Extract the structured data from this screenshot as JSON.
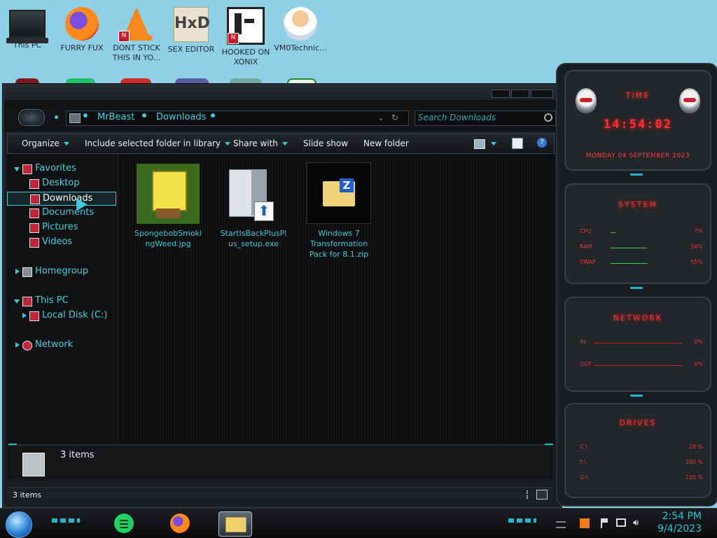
{
  "desktop": {
    "icons": [
      {
        "label": "This PC"
      },
      {
        "label": "FURRY FUX"
      },
      {
        "label": "DONT STICK THIS IN YO..."
      },
      {
        "label": "SEX EDITOR"
      },
      {
        "label": "HOOKED ON XONIX"
      },
      {
        "label": "VM0Technic..."
      }
    ]
  },
  "explorer": {
    "breadcrumb": [
      "MrBeast",
      "Downloads"
    ],
    "search_placeholder": "Search Downloads",
    "toolbar": {
      "organize": "Organize",
      "include": "Include selected folder in library",
      "share": "Share with",
      "slideshow": "Slide show",
      "new_folder": "New folder"
    },
    "nav": {
      "favorites": "Favorites",
      "desktop": "Desktop",
      "downloads": "Downloads",
      "documents": "Documents",
      "pictures": "Pictures",
      "videos": "Videos",
      "homegroup": "Homegroup",
      "this_pc": "This PC",
      "local_disk": "Local Disk (C:)",
      "network": "Network"
    },
    "files": [
      {
        "name": "SpongebobSmokingWeed.jpg"
      },
      {
        "name": "StartIsBackPlusPlus_setup.exe"
      },
      {
        "name": "Windows 7 Transformation Pack for 8.1.zip"
      }
    ],
    "details_count": "3 items",
    "status_count": "3 items"
  },
  "gadget": {
    "time_title": "TIME",
    "clock": "14:54:02",
    "date": "MONDAY 04 SEPTEMBER 2023",
    "system_title": "SYSTEM",
    "system": [
      {
        "label": "CPU",
        "value": "7%",
        "level": 0.07
      },
      {
        "label": "RAM",
        "value": "54%",
        "level": 0.54
      },
      {
        "label": "SWAP",
        "value": "55%",
        "level": 0.55
      }
    ],
    "network_title": "NETWORK",
    "network": [
      {
        "label": "IN",
        "value": "0%"
      },
      {
        "label": "OUT",
        "value": "0%"
      }
    ],
    "drives_title": "DRIVES",
    "drives": [
      {
        "label": "C:\\",
        "value": "28 %"
      },
      {
        "label": "F:\\",
        "value": "100 %"
      },
      {
        "label": "G:\\",
        "value": "100 %"
      }
    ]
  },
  "taskbar": {
    "time": "2:54 PM",
    "date": "9/4/2023"
  },
  "colors": {
    "accent": "#3fc6d4",
    "gadget_red": "#e3313a",
    "desktop_bg": "#8fd0e6"
  }
}
